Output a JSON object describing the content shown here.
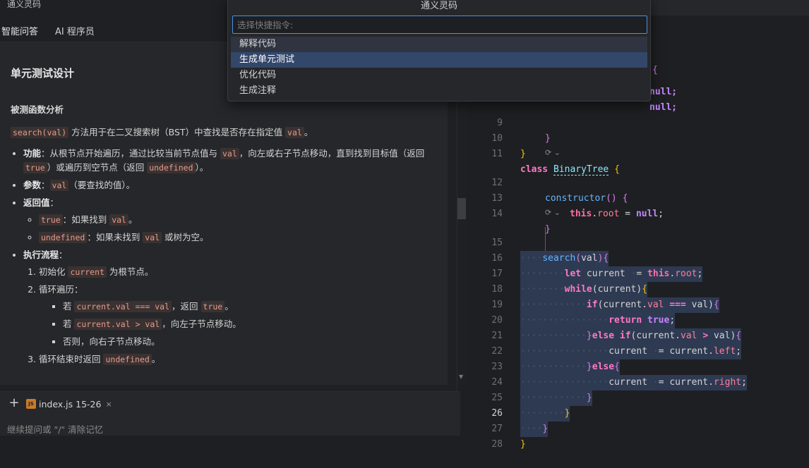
{
  "app": {
    "title": "通义灵码"
  },
  "tabs": [
    {
      "label": "智能问答",
      "active": true
    },
    {
      "label": "AI 程序员",
      "active": false
    }
  ],
  "answer": {
    "heading": "单元测试设计",
    "subheading": "被测函数分析",
    "intro_code": "search(val)",
    "intro_text": " 方法用于在二叉搜索树（BST）中查找是否存在指定值 ",
    "intro_code2": "val",
    "intro_end": "。",
    "func_label": "功能",
    "func_text1": "：从根节点开始遍历，通过比较当前节点值与 ",
    "func_code1": "val",
    "func_text2": "，向左或右子节点移动，直到找到目标值（返回 ",
    "func_code2": "true",
    "func_text3": "）或遍历到空节点（返回 ",
    "func_code3": "undefined",
    "func_text4": "）。",
    "param_label": "参数",
    "param_sep": "：",
    "param_code": "val",
    "param_text": "（要查找的值）。",
    "ret_label": "返回值",
    "ret_sep": "：",
    "ret_items": [
      {
        "code": "true",
        "text": "：如果找到 ",
        "code2": "val",
        "end": "。"
      },
      {
        "code": "undefined",
        "text": "：如果未找到 ",
        "code2": "val",
        "end": " 或树为空。"
      }
    ],
    "flow_label": "执行流程",
    "flow_sep": "：",
    "step1_text": "初始化 ",
    "step1_code": "current",
    "step1_end": " 为根节点。",
    "step2_text": "循环遍历：",
    "step2_items": [
      {
        "pre": "若 ",
        "code": "current.val === val",
        "mid": "，返回 ",
        "code2": "true",
        "end": "。"
      },
      {
        "pre": "若 ",
        "code": "current.val > val",
        "mid": "，向左子节点移动。"
      },
      {
        "pre": "否则，向右子节点移动。"
      }
    ],
    "step3_text": "循环结束时返回 ",
    "step3_code": "undefined",
    "step3_end": "。"
  },
  "composer": {
    "add_icon": "plus-icon",
    "file_icon": "javascript-file-icon",
    "file_label": "index.js 15-26",
    "close_glyph": "×",
    "placeholder": "继续提问或 \"/\" 清除记忆"
  },
  "palette": {
    "title": "通义灵码",
    "placeholder": "选择快捷指令:",
    "items": [
      {
        "label": "解释代码",
        "state": "hover"
      },
      {
        "label": "生成单元测试",
        "state": "selected"
      },
      {
        "label": "优化代码",
        "state": "normal"
      },
      {
        "label": "生成注释",
        "state": "normal"
      }
    ]
  },
  "editor": {
    "current_line": 26,
    "codelens_glyph": "⟳ ⌄",
    "lines": [
      {
        "n": "",
        "code": "{"
      },
      {
        "n": "",
        "code": "null;"
      },
      {
        "n": "",
        "code": "null;"
      },
      {
        "n": "9",
        "code": "}"
      },
      {
        "n": "10",
        "code": "}"
      },
      {
        "n": "11",
        "code": "class BinaryTree {"
      },
      {
        "n": "12",
        "code": "constructor() {"
      },
      {
        "n": "13",
        "code": "this.root = null;"
      },
      {
        "n": "14",
        "code": "}"
      },
      {
        "n": "15",
        "code": "search(val){"
      },
      {
        "n": "16",
        "code": "let current = this.root;"
      },
      {
        "n": "17",
        "code": "while(current){"
      },
      {
        "n": "18",
        "code": "if(current.val === val){"
      },
      {
        "n": "19",
        "code": "return true;"
      },
      {
        "n": "20",
        "code": "}else if(current.val > val){"
      },
      {
        "n": "21",
        "code": "current = current.left;"
      },
      {
        "n": "22",
        "code": "}else{"
      },
      {
        "n": "23",
        "code": "current = current.right;"
      },
      {
        "n": "24",
        "code": "}"
      },
      {
        "n": "25",
        "code": "}"
      },
      {
        "n": "26",
        "code": "}"
      },
      {
        "n": "27",
        "code": "}"
      },
      {
        "n": "28",
        "code": ""
      }
    ]
  },
  "colors": {
    "accent": "#4a90e2",
    "selection": "#2e3a52",
    "keyword": "#ff79c6",
    "class_name": "#8be9fd",
    "property": "#ff7f98"
  }
}
